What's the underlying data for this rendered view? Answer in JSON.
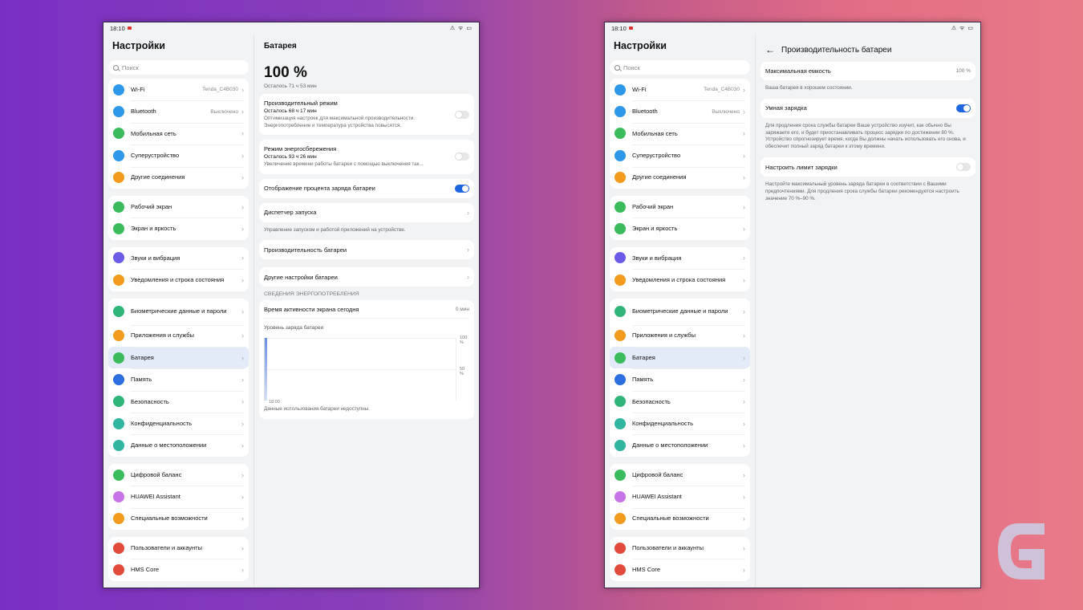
{
  "status": {
    "time": "18:10",
    "icons": "⚠ ᯤ ▭"
  },
  "sidebar": {
    "title": "Настройки",
    "search_placeholder": "Поиск",
    "groups": [
      [
        {
          "label": "Wi-Fi",
          "value": "Tenda_C4B030",
          "icon": "wifi-icon",
          "color": "#2d97ea"
        },
        {
          "label": "Bluetooth",
          "value": "Выключено",
          "icon": "bluetooth-icon",
          "color": "#2d97ea"
        },
        {
          "label": "Мобильная сеть",
          "value": "",
          "icon": "signal-icon",
          "color": "#3bbc5c"
        },
        {
          "label": "Суперустройство",
          "value": "",
          "icon": "superdevice-icon",
          "color": "#2d97ea"
        },
        {
          "label": "Другие соединения",
          "value": "",
          "icon": "link-icon",
          "color": "#f39b1d"
        }
      ],
      [
        {
          "label": "Рабочий экран",
          "icon": "home-screen-icon",
          "color": "#3bbc5c"
        },
        {
          "label": "Экран и яркость",
          "icon": "eye-icon",
          "color": "#3bbc5c"
        }
      ],
      [
        {
          "label": "Звуки и вибрация",
          "icon": "sound-icon",
          "color": "#6c5ce7"
        },
        {
          "label": "Уведомления и строка состояния",
          "icon": "bell-icon",
          "color": "#f39b1d"
        }
      ],
      [
        {
          "label": "Биометрические данные и пароли",
          "icon": "key-icon",
          "color": "#2fb57a"
        },
        {
          "label": "Приложения и службы",
          "icon": "apps-icon",
          "color": "#f39b1d"
        },
        {
          "label": "Батарея",
          "icon": "battery-icon",
          "color": "#3bbc5c"
        },
        {
          "label": "Память",
          "icon": "storage-icon",
          "color": "#2d6fe0"
        },
        {
          "label": "Безопасность",
          "icon": "shield-icon",
          "color": "#2fb57a"
        },
        {
          "label": "Конфиденциальность",
          "icon": "privacy-icon",
          "color": "#2fb5a0"
        },
        {
          "label": "Данные о местоположении",
          "icon": "location-icon",
          "color": "#2fb5a0"
        }
      ],
      [
        {
          "label": "Цифровой баланс",
          "icon": "hourglass-icon",
          "color": "#3bbc5c"
        },
        {
          "label": "HUAWEI Assistant",
          "icon": "assistant-icon",
          "color": "#c774e8"
        },
        {
          "label": "Специальные возможности",
          "icon": "hand-icon",
          "color": "#f39b1d"
        }
      ],
      [
        {
          "label": "Пользователи и аккаунты",
          "icon": "user-icon",
          "color": "#e24a3b"
        },
        {
          "label": "HMS Core",
          "icon": "hms-icon",
          "color": "#e24a3b"
        }
      ]
    ]
  },
  "battery": {
    "title": "Батарея",
    "level": "100 %",
    "remaining": "Осталось 71 ч 53 мин",
    "perf_mode": {
      "title": "Производительный режим",
      "remaining": "Осталось 68 ч 17 мин",
      "desc": "Оптимизация настроек для максимальной производительности. Энергопотребление и температура устройства повысятся."
    },
    "saver_mode": {
      "title": "Режим энергосбережения",
      "remaining": "Осталось 93 ч 26 мин",
      "desc": "Увеличение времени работы батареи с помощью выключения так..."
    },
    "show_percent": "Отображение процента заряда батареи",
    "launch_manager": "Диспетчер запуска",
    "launch_note": "Управление запуском и работой приложений на устройстве.",
    "performance": "Производительность батареи",
    "other_settings": "Другие настройки батареи",
    "section": "СВЕДЕНИЯ ЭНЕРГОПОТРЕБЛЕНИЯ",
    "screen_time": "Время активности экрана сегодня",
    "screen_time_val": "0 мин",
    "chart_title": "Уровень заряда батареи",
    "unavailable": "Данные использования батареи недоступны."
  },
  "chart_data": {
    "type": "bar",
    "title": "Уровень заряда батареи",
    "categories": [
      "18:00"
    ],
    "values": [
      100
    ],
    "ytick_labels": [
      "100 %",
      "50 %"
    ],
    "ylim": [
      0,
      100
    ]
  },
  "perf_page": {
    "title": "Производительность батареи",
    "max_capacity": "Максимальная емкость",
    "max_capacity_val": "100 %",
    "capacity_note": "Ваша батарея в хорошем состоянии.",
    "smart_charge": "Умная зарядка",
    "smart_note": "Для продления срока службы батареи Ваше устройство изучит, как обычно Вы заряжаете его, и будет приостанавливать процесс зарядки по достижении 80 %. Устройство спрогнозирует время, когда Вы должны начать использовать его снова, и обеспечит полный заряд батареи к этому времени.",
    "limit": "Настроить лимит зарядки",
    "limit_note": "Настройте максимальный уровень заряда батареи в соответствии с Вашими предпочтениями. Для продления срока службы батареи рекомендуется настроить значение 70 %–90 %."
  },
  "colors": {
    "accent": "#1e66e0",
    "active_bg": "#e3ebf8"
  }
}
